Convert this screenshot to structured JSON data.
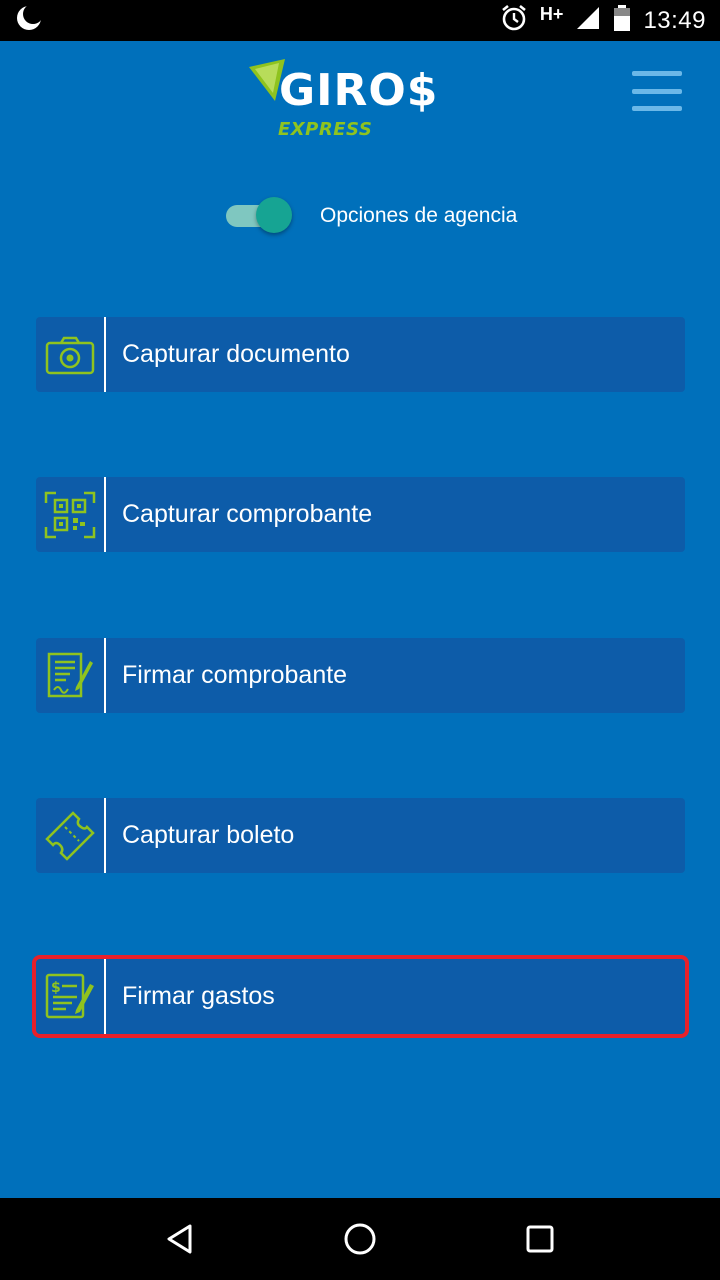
{
  "status_bar": {
    "network": "H+",
    "time": "13:49",
    "icons": [
      "moon-icon",
      "alarm-icon",
      "signal-icon",
      "battery-icon"
    ]
  },
  "header": {
    "logo_text": "GIRO$",
    "logo_subtext": "EXPRESS",
    "menu_icon": "hamburger-menu-icon"
  },
  "toggle": {
    "label": "Opciones de agencia",
    "state": "on"
  },
  "actions": [
    {
      "label": "Capturar documento",
      "icon": "camera-icon"
    },
    {
      "label": "Capturar comprobante",
      "icon": "qr-code-icon"
    },
    {
      "label": "Firmar comprobante",
      "icon": "signed-document-icon"
    },
    {
      "label": "Capturar boleto",
      "icon": "ticket-icon"
    },
    {
      "label": "Firmar gastos",
      "icon": "signed-expense-icon",
      "selected": true
    }
  ],
  "colors": {
    "background": "#0070bb",
    "button": "#0d5ca9",
    "accent_green": "#8fc31f",
    "toggle": "#16a493",
    "highlight": "#e8202a"
  },
  "nav_bar": {
    "icons": [
      "back-icon",
      "home-icon",
      "recents-icon"
    ]
  }
}
